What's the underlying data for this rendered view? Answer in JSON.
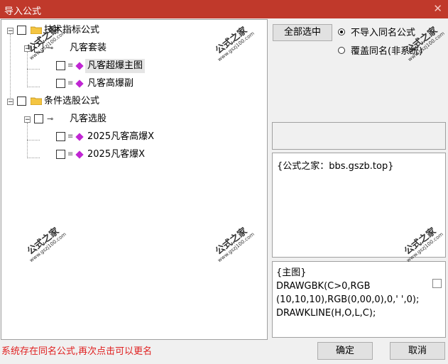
{
  "window": {
    "title": "导入公式",
    "close_icon": "close-icon"
  },
  "tree": [
    {
      "label": "技术指标公式",
      "icon": "folder-icon"
    },
    {
      "label": "凡客套装",
      "icon": "key-icon"
    },
    {
      "label": "凡客超爆主图",
      "icon": "formula-gem-icon",
      "selected": true
    },
    {
      "label": "凡客高爆副",
      "icon": "formula-gem-icon"
    },
    {
      "label": "条件选股公式",
      "icon": "folder-icon"
    },
    {
      "label": "凡客选股",
      "icon": "key-icon"
    },
    {
      "label": "2025凡客高爆X",
      "icon": "formula-gem-icon"
    },
    {
      "label": "2025凡客爆X",
      "icon": "formula-gem-icon"
    }
  ],
  "watermark": {
    "name": "公式之家",
    "url": "www.gszj100.com"
  },
  "options": {
    "select_all_label": "全部选中",
    "radio1_label": "不导入同名公式",
    "radio2_label": "覆盖同名(非系统)",
    "radio1_checked": true
  },
  "description": "{公式之家：bbs.gszb.top}",
  "code": {
    "header": "{主图}",
    "line1": "DRAWGBK(C>0,RGB",
    "line2": "(10,10,10),RGB(0,00,0),0,' ',0);",
    "line3": "DRAWKLINE(H,O,L,C);"
  },
  "status_text": "系统存在同名公式,再次点击可以更名",
  "buttons": {
    "ok": "确定",
    "cancel": "取消"
  }
}
